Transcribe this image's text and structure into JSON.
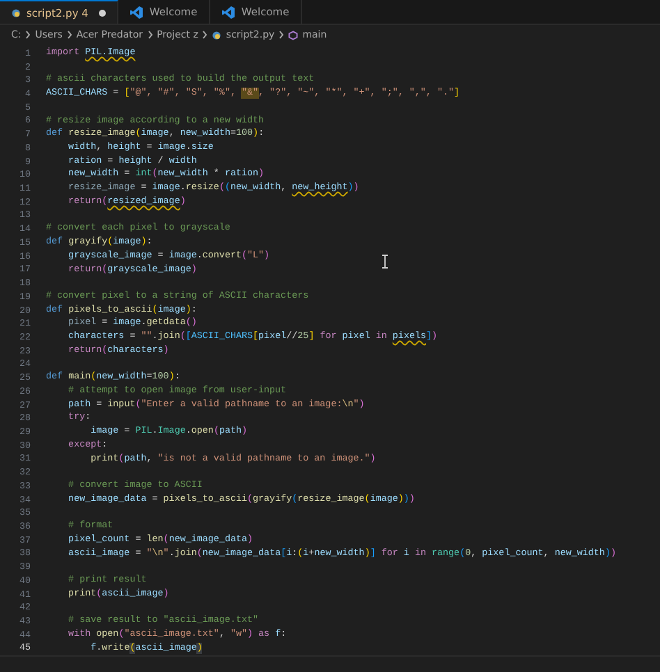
{
  "tabs": [
    {
      "kind": "file",
      "label": "script2.py",
      "badge": "4",
      "selected": true,
      "modified": true
    },
    {
      "kind": "welcome",
      "label": "Welcome",
      "selected": false,
      "modified": false
    },
    {
      "kind": "welcome",
      "label": "Welcome",
      "selected": false,
      "modified": false
    }
  ],
  "breadcrumbs": [
    {
      "kind": "folder",
      "label": "C:"
    },
    {
      "kind": "folder",
      "label": "Users"
    },
    {
      "kind": "folder",
      "label": "Acer Predator"
    },
    {
      "kind": "folder",
      "label": "Project z"
    },
    {
      "kind": "file",
      "label": "script2.py"
    },
    {
      "kind": "symbol",
      "label": "main"
    }
  ],
  "editor": {
    "lines": [
      {
        "n": "1",
        "current": false,
        "tokens": [
          {
            "kind": "ctl",
            "text": "import "
          },
          {
            "kind": "warn",
            "text": "PIL.Image"
          }
        ]
      },
      {
        "n": "2",
        "current": false
      },
      {
        "n": "3",
        "current": false,
        "tokens": [
          {
            "kind": "cm",
            "text": "# ascii characters used to build the output text"
          }
        ]
      },
      {
        "n": "4",
        "current": false,
        "tokens": [
          {
            "kind": "var",
            "text": "ASCII_CHARS"
          },
          {
            "kind": "p",
            "text": " = "
          },
          {
            "kind": "b1",
            "text": "["
          },
          {
            "kind": "str",
            "text": "\"@\", \"#\", \"S\", \"%\", "
          },
          {
            "kind": "hl",
            "text": "\"&\""
          },
          {
            "kind": "str",
            "text": ", \"?\", \"~\", \"*\", \"+\", \";\", \",\", \".\""
          },
          {
            "kind": "b1",
            "text": "]"
          }
        ]
      },
      {
        "n": "5",
        "current": false
      },
      {
        "n": "6",
        "current": false,
        "tokens": [
          {
            "kind": "cm",
            "text": "# resize image according to a new width"
          }
        ]
      },
      {
        "n": "7",
        "current": false,
        "tokens": [
          {
            "kind": "kw",
            "text": "def "
          },
          {
            "kind": "fn",
            "text": "resize_image"
          },
          {
            "kind": "b1",
            "text": "("
          },
          {
            "kind": "var",
            "text": "image"
          },
          {
            "kind": "p",
            "text": ", "
          },
          {
            "kind": "var",
            "text": "new_width"
          },
          {
            "kind": "p",
            "text": "="
          },
          {
            "kind": "num",
            "text": "100"
          },
          {
            "kind": "b1",
            "text": ")"
          },
          {
            "kind": "p",
            "text": ":"
          }
        ]
      },
      {
        "n": "8",
        "current": false,
        "tokens": [
          {
            "kind": "var",
            "text": "    width"
          },
          {
            "kind": "p",
            "text": ", "
          },
          {
            "kind": "var",
            "text": "height"
          },
          {
            "kind": "p",
            "text": " = "
          },
          {
            "kind": "var",
            "text": "image"
          },
          {
            "kind": "p",
            "text": "."
          },
          {
            "kind": "var",
            "text": "size"
          }
        ]
      },
      {
        "n": "9",
        "current": false,
        "tokens": [
          {
            "kind": "var",
            "text": "    ration"
          },
          {
            "kind": "p",
            "text": " = "
          },
          {
            "kind": "var",
            "text": "height"
          },
          {
            "kind": "p",
            "text": " / "
          },
          {
            "kind": "var",
            "text": "width"
          }
        ]
      },
      {
        "n": "10",
        "current": false,
        "tokens": [
          {
            "kind": "var",
            "text": "    new_width"
          },
          {
            "kind": "p",
            "text": " = "
          },
          {
            "kind": "cls",
            "text": "int"
          },
          {
            "kind": "b2",
            "text": "("
          },
          {
            "kind": "var",
            "text": "new_width"
          },
          {
            "kind": "p",
            "text": " * "
          },
          {
            "kind": "var",
            "text": "ration"
          },
          {
            "kind": "b2",
            "text": ")"
          }
        ]
      },
      {
        "n": "11",
        "current": false,
        "tokens": [
          {
            "kind": "dim",
            "text": "    resize_image"
          },
          {
            "kind": "p",
            "text": " = "
          },
          {
            "kind": "var",
            "text": "image"
          },
          {
            "kind": "p",
            "text": "."
          },
          {
            "kind": "fn",
            "text": "resize"
          },
          {
            "kind": "b2",
            "text": "("
          },
          {
            "kind": "b3",
            "text": "("
          },
          {
            "kind": "var",
            "text": "new_width"
          },
          {
            "kind": "p",
            "text": ", "
          },
          {
            "kind": "warn",
            "text": "new_height"
          },
          {
            "kind": "b3",
            "text": ")"
          },
          {
            "kind": "b2",
            "text": ")"
          }
        ]
      },
      {
        "n": "12",
        "current": false,
        "tokens": [
          {
            "kind": "ctl",
            "text": "    return"
          },
          {
            "kind": "b2",
            "text": "("
          },
          {
            "kind": "warn",
            "text": "resized_image"
          },
          {
            "kind": "b2",
            "text": ")"
          }
        ]
      },
      {
        "n": "13",
        "current": false
      },
      {
        "n": "14",
        "current": false,
        "tokens": [
          {
            "kind": "cm",
            "text": "# convert each pixel to grayscale"
          }
        ]
      },
      {
        "n": "15",
        "current": false,
        "tokens": [
          {
            "kind": "kw",
            "text": "def "
          },
          {
            "kind": "fn",
            "text": "grayify"
          },
          {
            "kind": "b1",
            "text": "("
          },
          {
            "kind": "var",
            "text": "image"
          },
          {
            "kind": "b1",
            "text": ")"
          },
          {
            "kind": "p",
            "text": ":"
          }
        ]
      },
      {
        "n": "16",
        "current": false,
        "tokens": [
          {
            "kind": "var",
            "text": "    grayscale_image"
          },
          {
            "kind": "p",
            "text": " = "
          },
          {
            "kind": "var",
            "text": "image"
          },
          {
            "kind": "p",
            "text": "."
          },
          {
            "kind": "fn",
            "text": "convert"
          },
          {
            "kind": "b2",
            "text": "("
          },
          {
            "kind": "str",
            "text": "\"L\""
          },
          {
            "kind": "b2",
            "text": ")"
          }
        ]
      },
      {
        "n": "17",
        "current": false,
        "tokens": [
          {
            "kind": "ctl",
            "text": "    return"
          },
          {
            "kind": "b2",
            "text": "("
          },
          {
            "kind": "var",
            "text": "grayscale_image"
          },
          {
            "kind": "b2",
            "text": ")"
          }
        ]
      },
      {
        "n": "18",
        "current": false
      },
      {
        "n": "19",
        "current": false,
        "tokens": [
          {
            "kind": "cm",
            "text": "# convert pixel to a string of ASCII characters"
          }
        ]
      },
      {
        "n": "20",
        "current": false,
        "tokens": [
          {
            "kind": "kw",
            "text": "def "
          },
          {
            "kind": "fn",
            "text": "pixels_to_ascii"
          },
          {
            "kind": "b1",
            "text": "("
          },
          {
            "kind": "var",
            "text": "image"
          },
          {
            "kind": "b1",
            "text": ")"
          },
          {
            "kind": "p",
            "text": ":"
          }
        ]
      },
      {
        "n": "21",
        "current": false,
        "tokens": [
          {
            "kind": "dim",
            "text": "    pixel"
          },
          {
            "kind": "p",
            "text": " = "
          },
          {
            "kind": "var",
            "text": "image"
          },
          {
            "kind": "p",
            "text": "."
          },
          {
            "kind": "fn",
            "text": "getdata"
          },
          {
            "kind": "b2",
            "text": "()"
          }
        ]
      },
      {
        "n": "22",
        "current": false,
        "tokens": [
          {
            "kind": "var",
            "text": "    characters"
          },
          {
            "kind": "p",
            "text": " = "
          },
          {
            "kind": "str",
            "text": "\"\""
          },
          {
            "kind": "p",
            "text": "."
          },
          {
            "kind": "fn",
            "text": "join"
          },
          {
            "kind": "b2",
            "text": "("
          },
          {
            "kind": "b3",
            "text": "["
          },
          {
            "kind": "cst",
            "text": "ASCII_CHARS"
          },
          {
            "kind": "b1",
            "text": "["
          },
          {
            "kind": "var",
            "text": "pixel"
          },
          {
            "kind": "p",
            "text": "//"
          },
          {
            "kind": "num",
            "text": "25"
          },
          {
            "kind": "b1",
            "text": "]"
          },
          {
            "kind": "ctl",
            "text": " for "
          },
          {
            "kind": "var",
            "text": "pixel"
          },
          {
            "kind": "ctl",
            "text": " in "
          },
          {
            "kind": "warn",
            "text": "pixels"
          },
          {
            "kind": "b3",
            "text": "]"
          },
          {
            "kind": "b2",
            "text": ")"
          }
        ]
      },
      {
        "n": "23",
        "current": false,
        "tokens": [
          {
            "kind": "ctl",
            "text": "    return"
          },
          {
            "kind": "b2",
            "text": "("
          },
          {
            "kind": "var",
            "text": "characters"
          },
          {
            "kind": "b2",
            "text": ")"
          }
        ]
      },
      {
        "n": "24",
        "current": false
      },
      {
        "n": "25",
        "current": false,
        "tokens": [
          {
            "kind": "kw",
            "text": "def "
          },
          {
            "kind": "fn",
            "text": "main"
          },
          {
            "kind": "b1",
            "text": "("
          },
          {
            "kind": "var",
            "text": "new_width"
          },
          {
            "kind": "p",
            "text": "="
          },
          {
            "kind": "num",
            "text": "100"
          },
          {
            "kind": "b1",
            "text": ")"
          },
          {
            "kind": "p",
            "text": ":"
          }
        ]
      },
      {
        "n": "26",
        "current": false,
        "tokens": [
          {
            "kind": "cm",
            "text": "    # attempt to open image from user-input"
          }
        ]
      },
      {
        "n": "27",
        "current": false,
        "tokens": [
          {
            "kind": "var",
            "text": "    path"
          },
          {
            "kind": "p",
            "text": " = "
          },
          {
            "kind": "fn",
            "text": "input"
          },
          {
            "kind": "b2",
            "text": "("
          },
          {
            "kind": "str",
            "text": "\"Enter a valid pathname to an image:"
          },
          {
            "kind": "esc",
            "text": "\\n"
          },
          {
            "kind": "str",
            "text": "\""
          },
          {
            "kind": "b2",
            "text": ")"
          }
        ]
      },
      {
        "n": "28",
        "current": false,
        "tokens": [
          {
            "kind": "ctl",
            "text": "    try"
          },
          {
            "kind": "p",
            "text": ":"
          }
        ]
      },
      {
        "n": "29",
        "current": false,
        "tokens": [
          {
            "kind": "var",
            "text": "        image"
          },
          {
            "kind": "p",
            "text": " = "
          },
          {
            "kind": "cls",
            "text": "PIL"
          },
          {
            "kind": "p",
            "text": "."
          },
          {
            "kind": "cls",
            "text": "Image"
          },
          {
            "kind": "p",
            "text": "."
          },
          {
            "kind": "fn",
            "text": "open"
          },
          {
            "kind": "b2",
            "text": "("
          },
          {
            "kind": "var",
            "text": "path"
          },
          {
            "kind": "b2",
            "text": ")"
          }
        ]
      },
      {
        "n": "30",
        "current": false,
        "tokens": [
          {
            "kind": "ctl",
            "text": "    except"
          },
          {
            "kind": "p",
            "text": ":"
          }
        ]
      },
      {
        "n": "31",
        "current": false,
        "tokens": [
          {
            "kind": "fn",
            "text": "        print"
          },
          {
            "kind": "b2",
            "text": "("
          },
          {
            "kind": "var",
            "text": "path"
          },
          {
            "kind": "p",
            "text": ", "
          },
          {
            "kind": "str",
            "text": "\"is not a valid pathname to an image.\""
          },
          {
            "kind": "b2",
            "text": ")"
          }
        ]
      },
      {
        "n": "32",
        "current": false
      },
      {
        "n": "33",
        "current": false,
        "tokens": [
          {
            "kind": "cm",
            "text": "    # convert image to ASCII"
          }
        ]
      },
      {
        "n": "34",
        "current": false,
        "tokens": [
          {
            "kind": "var",
            "text": "    new_image_data"
          },
          {
            "kind": "p",
            "text": " = "
          },
          {
            "kind": "fn",
            "text": "pixels_to_ascii"
          },
          {
            "kind": "b2",
            "text": "("
          },
          {
            "kind": "fn",
            "text": "grayify"
          },
          {
            "kind": "b3",
            "text": "("
          },
          {
            "kind": "fn",
            "text": "resize_image"
          },
          {
            "kind": "b1",
            "text": "("
          },
          {
            "kind": "var",
            "text": "image"
          },
          {
            "kind": "b1",
            "text": ")"
          },
          {
            "kind": "b3",
            "text": ")"
          },
          {
            "kind": "b2",
            "text": ")"
          }
        ]
      },
      {
        "n": "35",
        "current": false
      },
      {
        "n": "36",
        "current": false,
        "tokens": [
          {
            "kind": "cm",
            "text": "    # format"
          }
        ]
      },
      {
        "n": "37",
        "current": false,
        "tokens": [
          {
            "kind": "var",
            "text": "    pixel_count"
          },
          {
            "kind": "p",
            "text": " = "
          },
          {
            "kind": "fn",
            "text": "len"
          },
          {
            "kind": "b2",
            "text": "("
          },
          {
            "kind": "var",
            "text": "new_image_data"
          },
          {
            "kind": "b2",
            "text": ")"
          }
        ]
      },
      {
        "n": "38",
        "current": false,
        "tokens": [
          {
            "kind": "var",
            "text": "    ascii_image"
          },
          {
            "kind": "p",
            "text": " = "
          },
          {
            "kind": "str",
            "text": "\""
          },
          {
            "kind": "esc",
            "text": "\\n"
          },
          {
            "kind": "str",
            "text": "\""
          },
          {
            "kind": "p",
            "text": "."
          },
          {
            "kind": "fn",
            "text": "join"
          },
          {
            "kind": "b2",
            "text": "("
          },
          {
            "kind": "var",
            "text": "new_image_data"
          },
          {
            "kind": "b3",
            "text": "["
          },
          {
            "kind": "var",
            "text": "i"
          },
          {
            "kind": "p",
            "text": ":"
          },
          {
            "kind": "b1",
            "text": "("
          },
          {
            "kind": "var",
            "text": "i"
          },
          {
            "kind": "p",
            "text": "+"
          },
          {
            "kind": "var",
            "text": "new_width"
          },
          {
            "kind": "b1",
            "text": ")"
          },
          {
            "kind": "b3",
            "text": "]"
          },
          {
            "kind": "ctl",
            "text": " for "
          },
          {
            "kind": "var",
            "text": "i"
          },
          {
            "kind": "ctl",
            "text": " in "
          },
          {
            "kind": "cls",
            "text": "range"
          },
          {
            "kind": "b3",
            "text": "("
          },
          {
            "kind": "num",
            "text": "0"
          },
          {
            "kind": "p",
            "text": ", "
          },
          {
            "kind": "var",
            "text": "pixel_count"
          },
          {
            "kind": "p",
            "text": ", "
          },
          {
            "kind": "var",
            "text": "new_width"
          },
          {
            "kind": "b3",
            "text": ")"
          },
          {
            "kind": "b2",
            "text": ")"
          }
        ]
      },
      {
        "n": "39",
        "current": false
      },
      {
        "n": "40",
        "current": false,
        "tokens": [
          {
            "kind": "cm",
            "text": "    # print result"
          }
        ]
      },
      {
        "n": "41",
        "current": false,
        "tokens": [
          {
            "kind": "fn",
            "text": "    print"
          },
          {
            "kind": "b2",
            "text": "("
          },
          {
            "kind": "var",
            "text": "ascii_image"
          },
          {
            "kind": "b2",
            "text": ")"
          }
        ]
      },
      {
        "n": "42",
        "current": false
      },
      {
        "n": "43",
        "current": false,
        "tokens": [
          {
            "kind": "cm",
            "text": "    # save result to \"ascii_image.txt\""
          }
        ]
      },
      {
        "n": "44",
        "current": false,
        "tokens": [
          {
            "kind": "ctl",
            "text": "    with "
          },
          {
            "kind": "fn",
            "text": "open"
          },
          {
            "kind": "b2",
            "text": "("
          },
          {
            "kind": "str",
            "text": "\"ascii_image.txt\""
          },
          {
            "kind": "p",
            "text": ", "
          },
          {
            "kind": "str",
            "text": "\"w\""
          },
          {
            "kind": "b2",
            "text": ")"
          },
          {
            "kind": "ctl",
            "text": " as "
          },
          {
            "kind": "var",
            "text": "f"
          },
          {
            "kind": "p",
            "text": ":"
          }
        ]
      },
      {
        "n": "45",
        "current": true,
        "tokens": [
          {
            "kind": "var",
            "text": "        f"
          },
          {
            "kind": "p",
            "text": "."
          },
          {
            "kind": "fn",
            "text": "write"
          },
          {
            "kind": "match",
            "text": "("
          },
          {
            "kind": "var",
            "text": "ascii_image"
          },
          {
            "kind": "match",
            "text": ")"
          }
        ]
      }
    ]
  }
}
